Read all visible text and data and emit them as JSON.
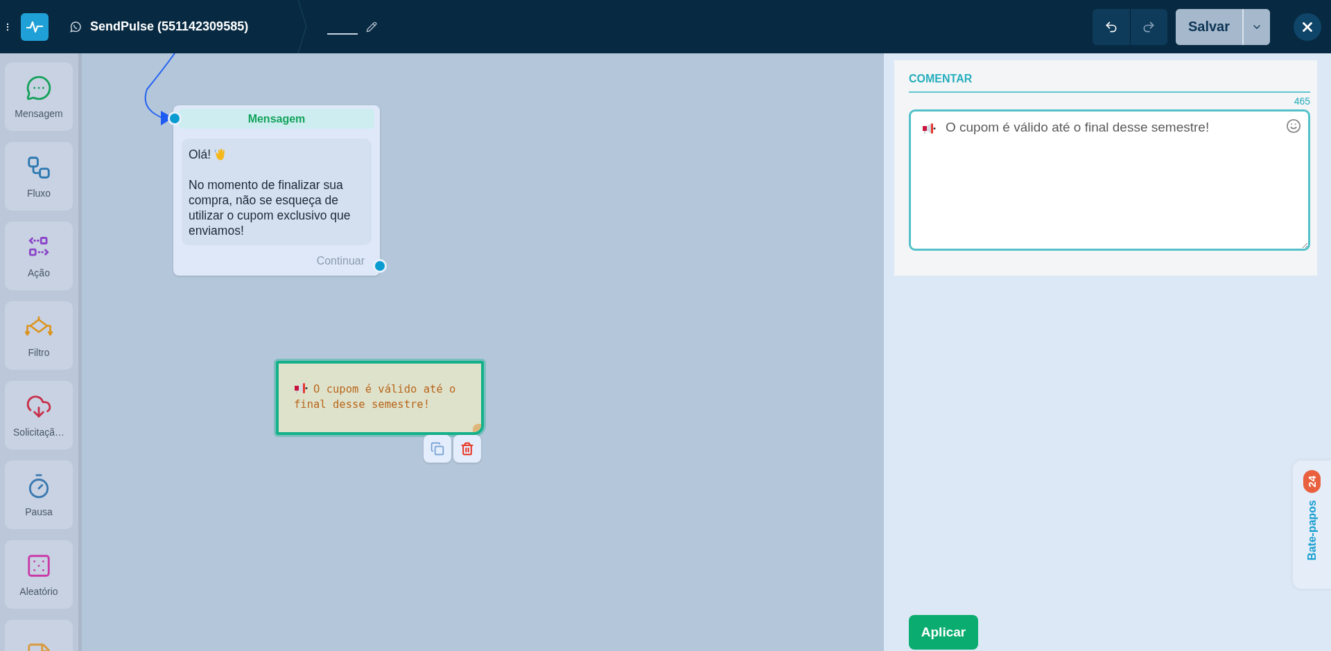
{
  "header": {
    "title": "SendPulse (551142309585)"
  },
  "toolbar": {
    "save_label": "Salvar"
  },
  "sidebar": {
    "items": [
      {
        "kind": "message",
        "label": "Mensagem"
      },
      {
        "kind": "flow",
        "label": "Fluxo"
      },
      {
        "kind": "action",
        "label": "Ação"
      },
      {
        "kind": "filter",
        "label": "Filtro"
      },
      {
        "kind": "request",
        "label": "Solicitaçã…"
      },
      {
        "kind": "pause",
        "label": "Pausa"
      },
      {
        "kind": "random",
        "label": "Aleatório"
      },
      {
        "kind": "note"
      }
    ]
  },
  "canvas": {
    "message_node": {
      "title": "Mensagem",
      "greeting": "Olá!",
      "body": "No momento de finalizar sua compra, não se esqueça de utilizar o cupom exclusivo que enviamos!",
      "button": "Continuar"
    },
    "note": {
      "text": "O cupom é válido até o final desse semestre!",
      "selected": true
    }
  },
  "panel": {
    "title": "COMENTAR",
    "counter": "465",
    "comment": "O cupom é válido até o final desse semestre!",
    "apply_label": "Aplicar"
  },
  "chat_tab": {
    "label": "Bate-papos",
    "badge": "24"
  }
}
